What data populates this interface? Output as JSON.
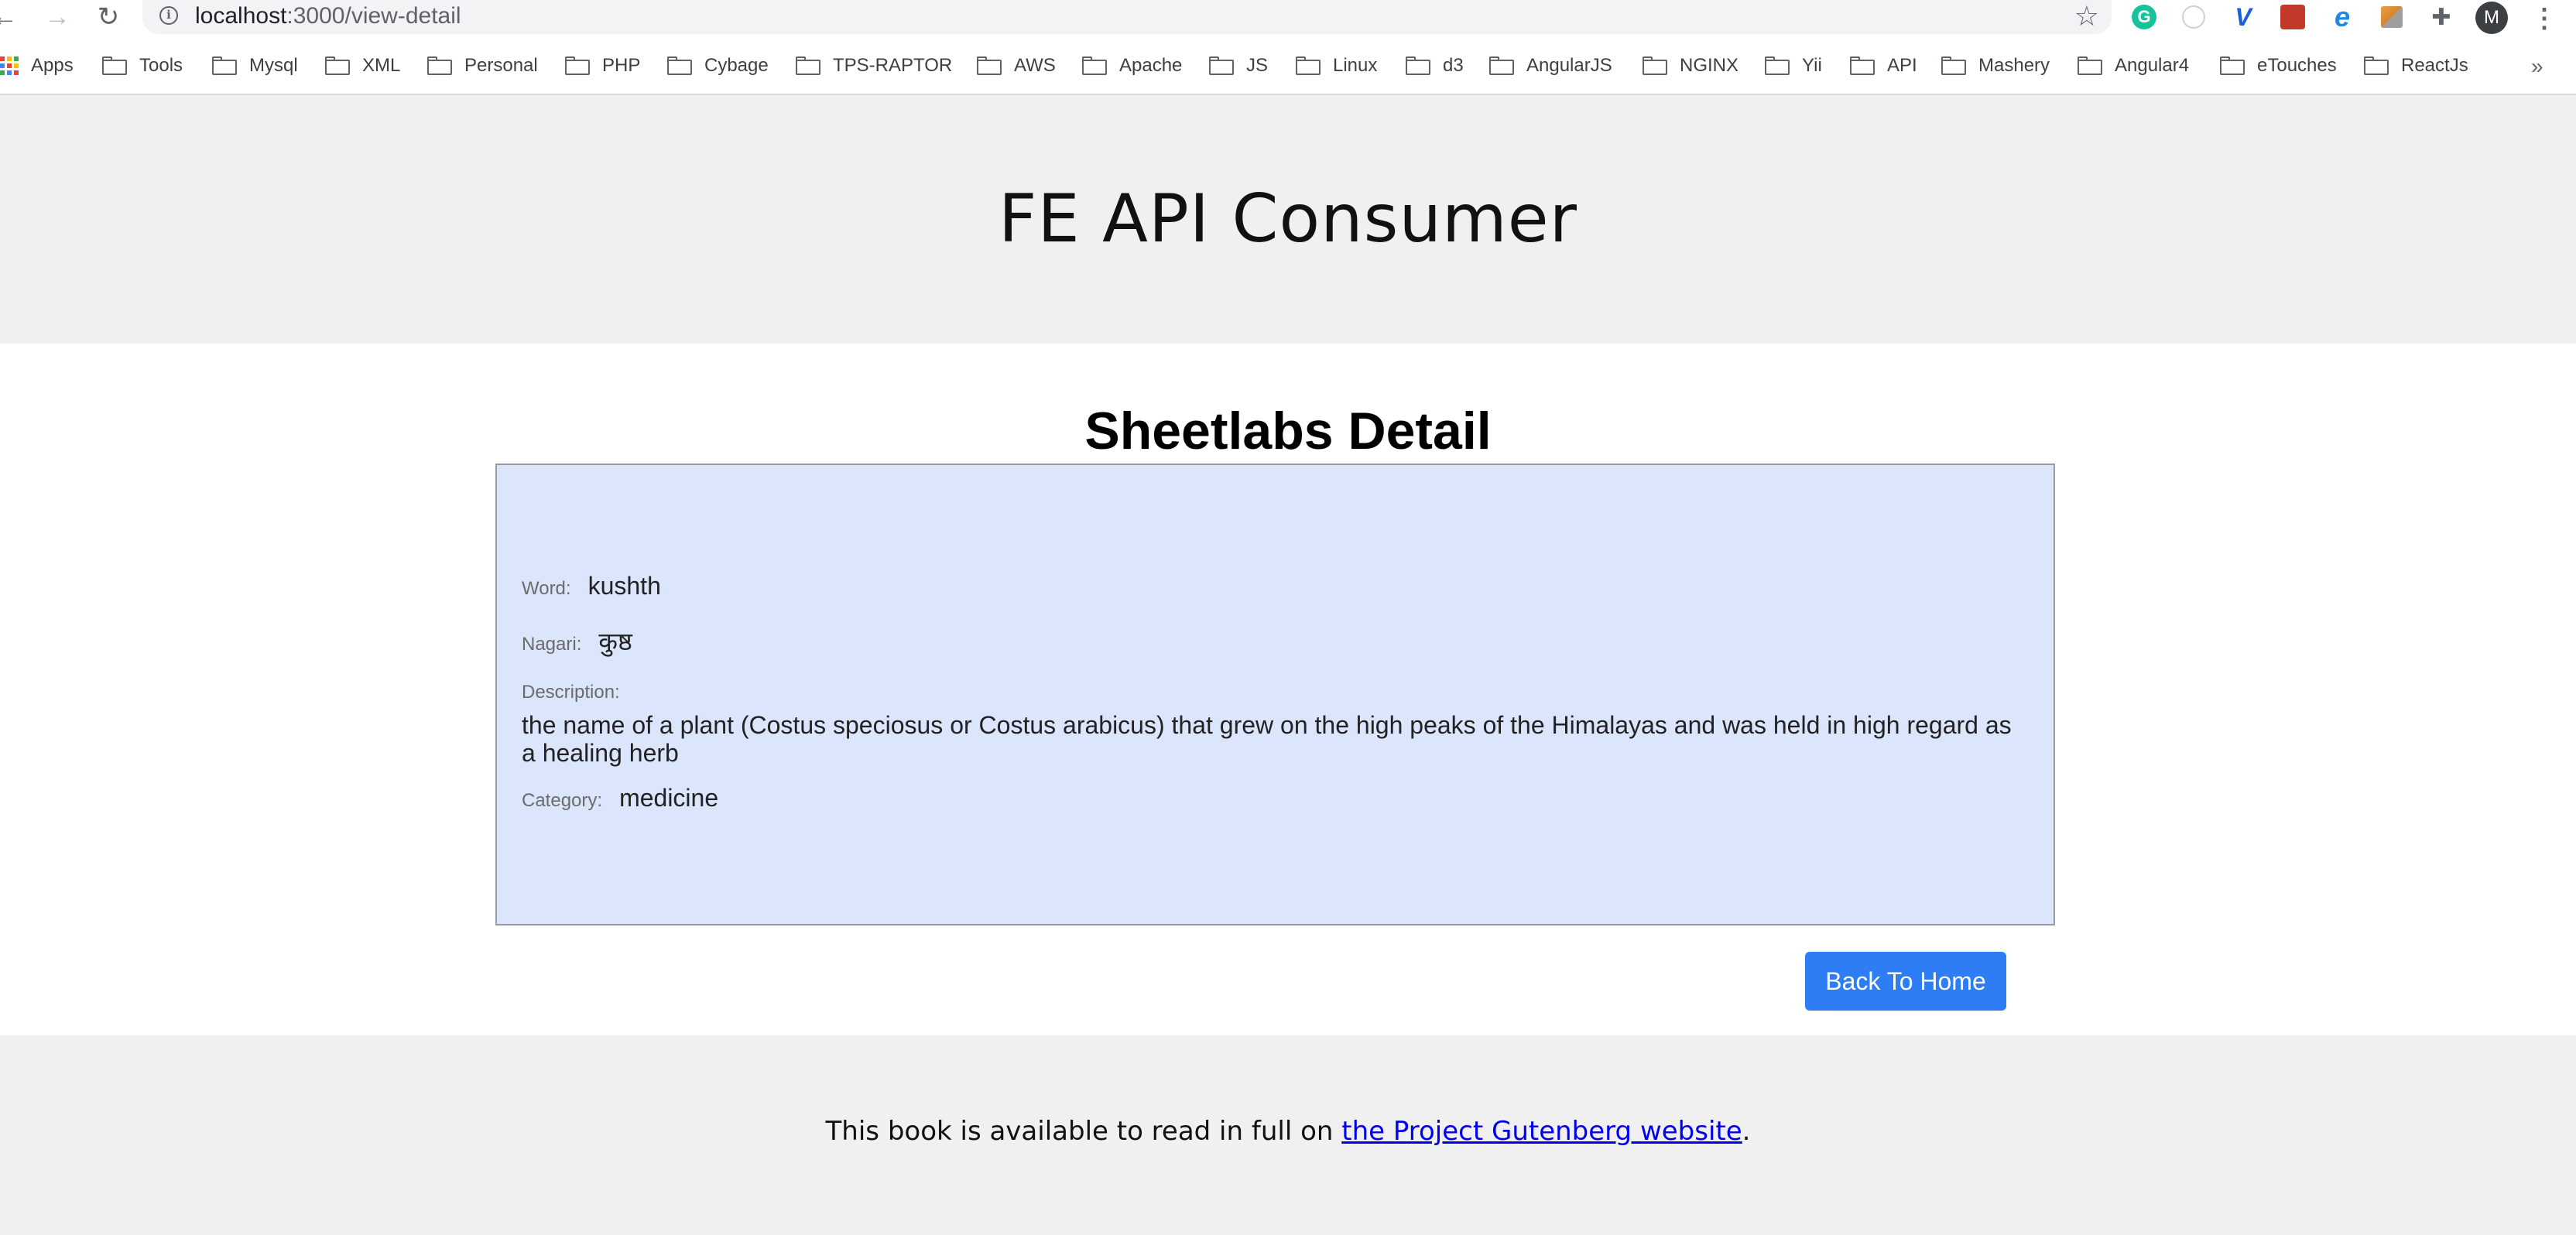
{
  "browser": {
    "url_host": "localhost",
    "url_path": ":3000/view-detail",
    "avatar_letter": "M",
    "bookmarks_overflow": "»",
    "bookmarks": [
      "Apps",
      "Tools",
      "Mysql",
      "XML",
      "Personal",
      "PHP",
      "Cybage",
      "TPS-RAPTOR",
      "AWS",
      "Apache",
      "JS",
      "Linux",
      "d3",
      "AngularJS",
      "NGINX",
      "Yii",
      "API",
      "Mashery",
      "Angular4",
      "eTouches",
      "ReactJs"
    ],
    "extensions": [
      "grammarly-icon",
      "ghost-extension-icon",
      "vue-devtools-icon",
      "red-extension-icon",
      "ie-tab-icon",
      "flag-extension-icon",
      "extensions-puzzle-icon"
    ]
  },
  "header": {
    "title": "FE API Consumer"
  },
  "detail": {
    "title": "Sheetlabs Detail",
    "word_label": "Word:",
    "word_value": "kushth",
    "nagari_label": "Nagari:",
    "nagari_value": "कुष्ठ",
    "description_label": "Description:",
    "description_value": "the name of a plant (Costus speciosus or Costus arabicus) that grew on the high peaks of the Himalayas and was held in high regard as a healing herb",
    "category_label": "Category:",
    "category_value": "medicine"
  },
  "actions": {
    "back_label": "Back To Home"
  },
  "footer": {
    "text_before": "This book is available to read in full on ",
    "link_text": "the Project Gutenberg website",
    "text_after": "."
  },
  "colors": {
    "card_background": "#dbe5fb",
    "button_primary": "#2f7df4",
    "header_background": "#f0f0f0",
    "link": "#0000ee"
  }
}
